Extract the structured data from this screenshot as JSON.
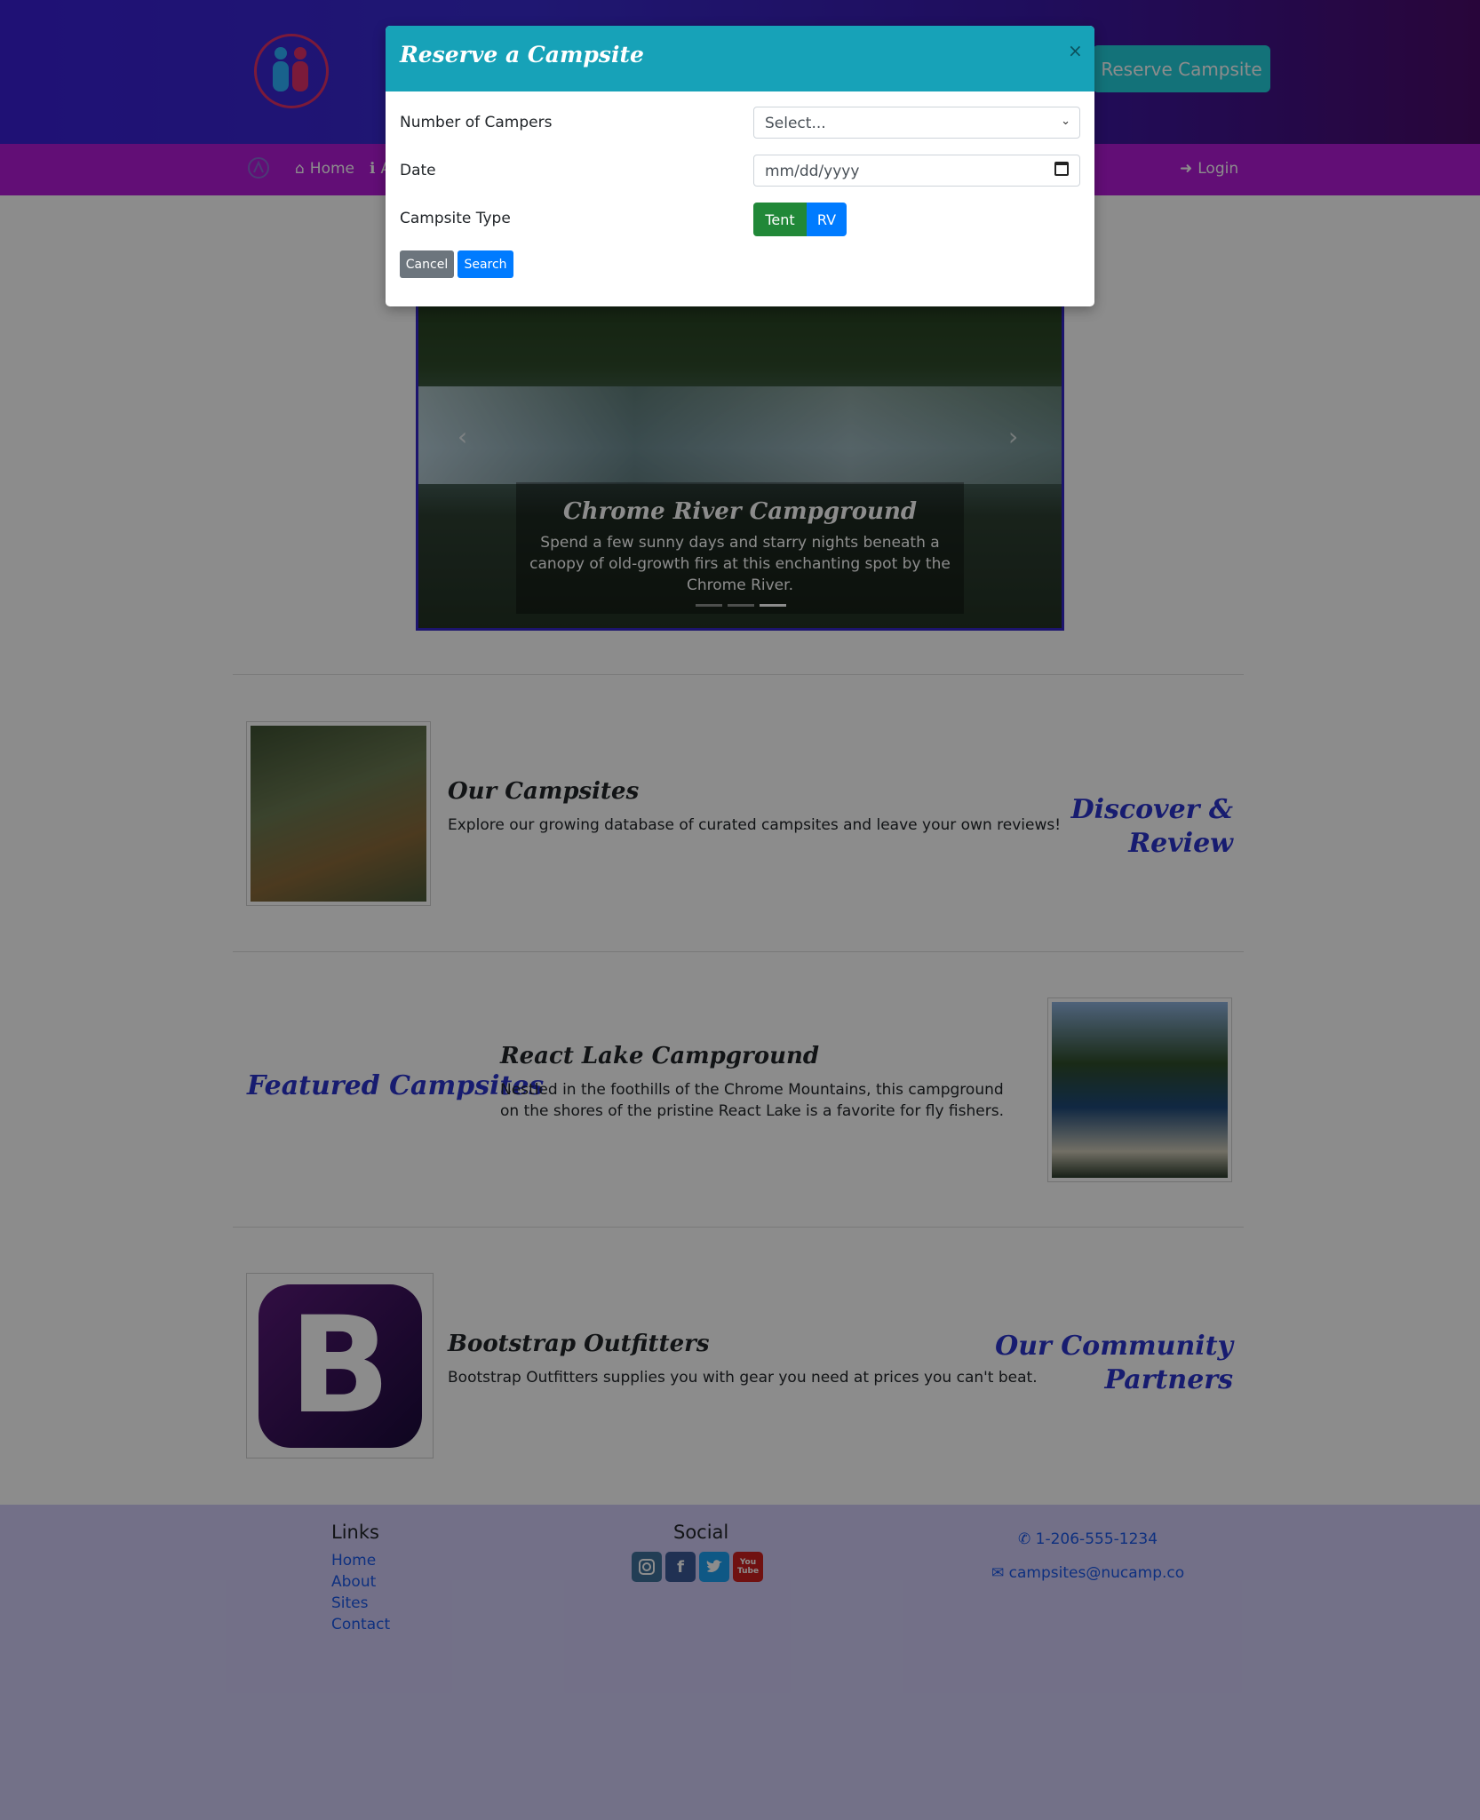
{
  "header": {
    "logo_icon": "nucamp-logo-icon",
    "reserve_button": "Reserve Campsite"
  },
  "nav": {
    "brand_icon": "brand-logo-icon",
    "items": [
      {
        "label": "Home",
        "icon": "home-icon"
      },
      {
        "label": "A",
        "icon": "info-icon"
      }
    ],
    "login": {
      "label": "Login",
      "icon": "sign-in-icon"
    }
  },
  "carousel": {
    "caption_title": "Chrome River Campground",
    "caption_text": "Spend a few sunny days and starry nights beneath a canopy of old-growth firs at this enchanting spot by the Chrome River.",
    "slide_count": 3,
    "active_slide": 3
  },
  "sections": [
    {
      "title": "Our Campsites",
      "text": "Explore our growing database of curated campsites and leave your own reviews!",
      "side_heading": "Discover & Review"
    },
    {
      "title": "React Lake Campground",
      "text": "Nestled in the foothills of the Chrome Mountains, this campground on the shores of the pristine React Lake is a favorite for fly fishers.",
      "side_heading": "Featured Campsites"
    },
    {
      "title": "Bootstrap Outfitters",
      "text": "Bootstrap Outfitters supplies you with gear you need at prices you can't beat.",
      "side_heading": "Our Community Partners",
      "logo_letter": "B"
    }
  ],
  "footer": {
    "links_heading": "Links",
    "links": [
      "Home",
      "About",
      "Sites",
      "Contact"
    ],
    "social_heading": "Social",
    "social_icons": [
      "instagram-icon",
      "facebook-icon",
      "twitter-icon",
      "youtube-icon"
    ],
    "youtube_label": "You Tube",
    "phone": "1-206-555-1234",
    "email": "campsites@nucamp.co"
  },
  "modal": {
    "title": "Reserve a Campsite",
    "close": "×",
    "fields": [
      {
        "label": "Number of Campers",
        "value": "Select..."
      },
      {
        "label": "Date",
        "placeholder": "mm/dd/yyyy"
      },
      {
        "label": "Campsite Type"
      }
    ],
    "campsite_types": [
      "Tent",
      "RV"
    ],
    "selected_type": "Tent",
    "cancel_button": "Cancel",
    "search_button": "Search"
  },
  "colors": {
    "header_gradient_start": "#3a1fd6",
    "navbar": "#b21ad8",
    "modal_header": "#17a2b8",
    "primary": "#007bff",
    "success": "#218838",
    "heading_blue": "#2a33cc"
  }
}
